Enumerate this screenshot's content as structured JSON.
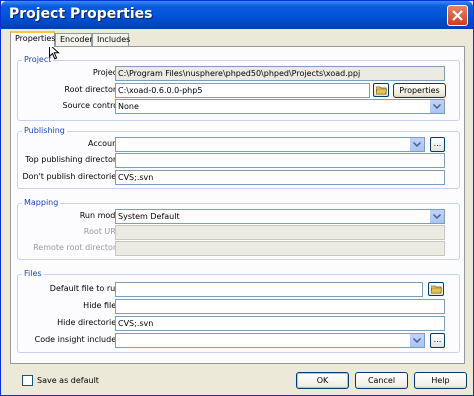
{
  "window": {
    "title": "Project Properties"
  },
  "tabs": [
    {
      "label": "Properties",
      "active": true
    },
    {
      "label": "Encoder",
      "active": false
    },
    {
      "label": "Includes",
      "active": false
    }
  ],
  "groups": {
    "project": {
      "title": "Project",
      "project_label": "Project:",
      "project_value": "C:\\Program Files\\nusphere\\phped50\\phped\\Projects\\xoad.ppj",
      "root_dir_label": "Root directory:",
      "root_dir_value": "C:\\xoad-0.6.0.0-php5",
      "root_dir_button": "Properties",
      "source_control_label": "Source control:",
      "source_control_value": "None"
    },
    "publishing": {
      "title": "Publishing",
      "account_label": "Account:",
      "account_value": "",
      "account_browse": "...",
      "top_dir_label": "Top publishing directory:",
      "top_dir_value": "",
      "dont_publish_label": "Don't publish directories:",
      "dont_publish_value": "CVS;.svn"
    },
    "mapping": {
      "title": "Mapping",
      "run_mode_label": "Run mode:",
      "run_mode_value": "System Default",
      "root_url_label": "Root URL:",
      "root_url_value": "",
      "remote_root_label": "Remote root directory:",
      "remote_root_value": ""
    },
    "files": {
      "title": "Files",
      "default_file_label": "Default file to run:",
      "default_file_value": "",
      "hide_files_label": "Hide files:",
      "hide_files_value": "",
      "hide_dirs_label": "Hide directories:",
      "hide_dirs_value": "CVS;.svn",
      "code_insight_label": "Code insight includes:",
      "code_insight_value": "",
      "code_insight_browse": "..."
    }
  },
  "footer": {
    "save_default_label": "Save as default",
    "save_default_checked": false,
    "ok_label": "OK",
    "cancel_label": "Cancel",
    "help_label": "Help"
  },
  "colors": {
    "titlebar": "#0052d6",
    "dialog_bg": "#ece9d8",
    "group_title": "#1c46b2",
    "active_tab_highlight": "#ffc83c"
  }
}
